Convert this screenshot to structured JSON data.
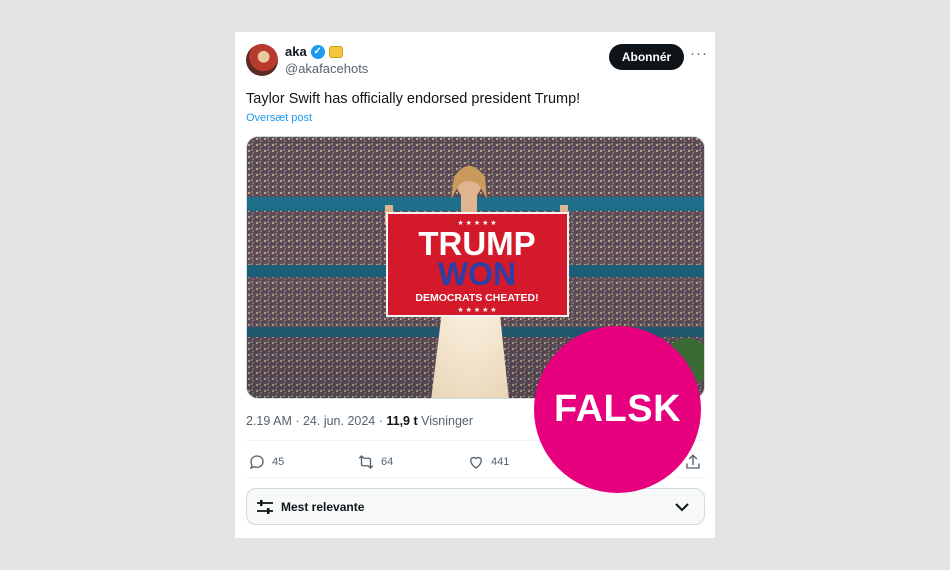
{
  "post": {
    "author_name": "aka",
    "author_handle": "@akafacehots",
    "follow_label": "Abonnér",
    "more_label": "···",
    "text": "Taylor Swift has officially endorsed president Trump!",
    "translate_label": "Oversæt post",
    "timestamp": "2.19 AM · 24. jun. 2024 · ",
    "views_count": "11,9 t",
    "views_label": " Visninger",
    "image": {
      "flag_line1": "TRUMP",
      "flag_line2": "WON",
      "flag_line3": "DEMOCRATS CHEATED!",
      "flag_stars": "★ ★ ★ ★ ★"
    },
    "actions": {
      "replies": "45",
      "reposts": "64",
      "likes": "441"
    }
  },
  "sort": {
    "label": "Mest relevante"
  },
  "overlay": {
    "label": "FALSK",
    "color": "#e6007e"
  },
  "icons": [
    "verified-badge-icon",
    "emoji-badge-icon",
    "reply-icon",
    "repost-icon",
    "like-icon",
    "share-icon",
    "sliders-icon",
    "chevron-down-icon"
  ]
}
